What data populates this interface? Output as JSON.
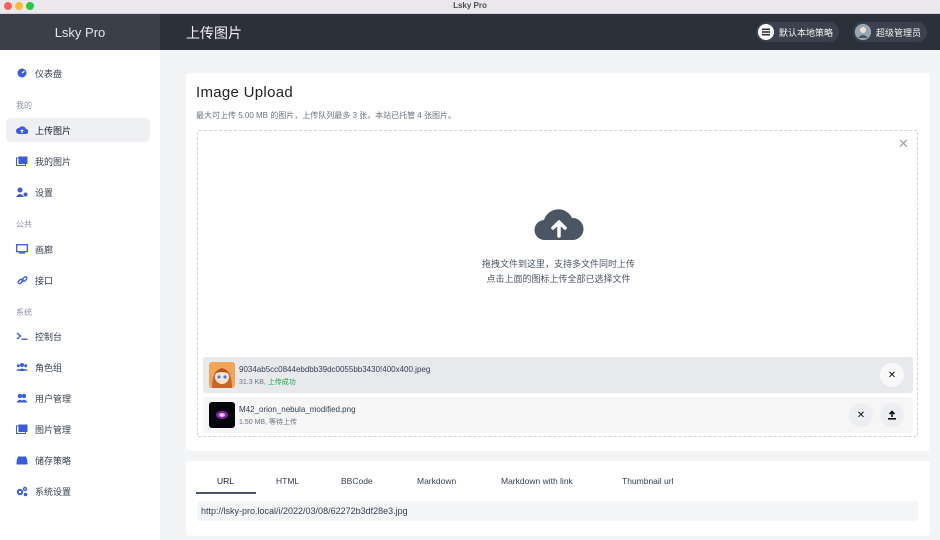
{
  "window": {
    "title": "Lsky Pro"
  },
  "header": {
    "brand": "Lsky Pro",
    "page_title": "上传图片",
    "strategy_label": "默认本地策略",
    "user_label": "超级管理员"
  },
  "sidebar": {
    "dashboard": "仪表盘",
    "section_mine": "我的",
    "upload": "上传图片",
    "my_images": "我的图片",
    "settings": "设置",
    "section_public": "公共",
    "gallery": "画廊",
    "api": "接口",
    "section_system": "系统",
    "console": "控制台",
    "roles": "角色组",
    "users": "用户管理",
    "images": "图片管理",
    "storage": "储存策略",
    "system_settings": "系统设置"
  },
  "upload": {
    "title": "Image Upload",
    "subtitle": "最大可上传 5.00 MB 的图片，上传队列最多 3 张，本站已托管 4 张图片。",
    "drop_line1": "拖拽文件到这里，支持多文件同时上传",
    "drop_line2": "点击上面的图标上传全部已选择文件",
    "files": [
      {
        "name": "9034ab5cc0844ebdbb39dc0055bb3430!400x400.jpeg",
        "size": "31.3 KB,",
        "status": "上传成功"
      },
      {
        "name": "M42_orion_nebula_modified.png",
        "size": "1.50 MB,",
        "status": "等待上传"
      }
    ]
  },
  "links": {
    "tabs": [
      "URL",
      "HTML",
      "BBCode",
      "Markdown",
      "Markdown with link",
      "Thumbnail url"
    ],
    "active_tab": "URL",
    "url_value": "http://lsky-pro.local/i/2022/03/08/62272b3df28e3.jpg"
  },
  "colors": {
    "header_bg": "#2b303a",
    "brand_bg": "#3a3f4a",
    "success": "#16a34a"
  }
}
